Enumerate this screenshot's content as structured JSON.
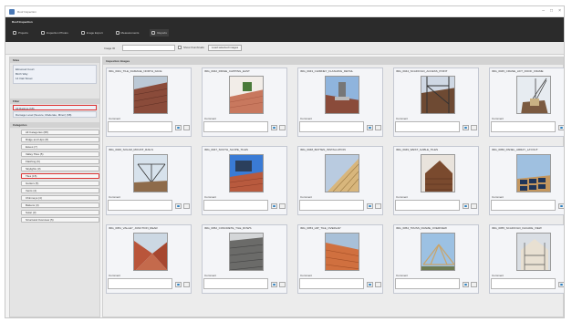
{
  "window": {
    "title": "Roof Inspection"
  },
  "ribbon": {
    "title": "Roof Inspection",
    "tabs": [
      {
        "label": "Projects",
        "active": false
      },
      {
        "label": "Inspection Photos",
        "active": false
      },
      {
        "label": "Image Export",
        "active": false
      },
      {
        "label": "Measurements",
        "active": false
      },
      {
        "label": "Reports",
        "active": true
      }
    ]
  },
  "toolbar": {
    "filter_label": "Image ID",
    "filter_value": "",
    "checkbox_label": "Show thumbnails",
    "button_label": "Load selected images"
  },
  "sidebar": {
    "sites_header": "Sites",
    "sites": [
      "Elmwood Court",
      "Birch Way",
      "14 Oak Street"
    ],
    "filter_header": "Filter",
    "filter_selected": "All Ratings (68)",
    "filter_combo": "Damage Level (Severe, Moderate, Minor) (68)",
    "category_header": "Categories",
    "categories": [
      {
        "label": "All Categories (68)",
        "highlighted": false
      },
      {
        "label": "Ridge and Hips (8)",
        "highlighted": false
      },
      {
        "label": "Eaves (7)",
        "highlighted": false
      },
      {
        "label": "Valley Tiles (5)",
        "highlighted": false
      },
      {
        "label": "Flashing (6)",
        "highlighted": false
      },
      {
        "label": "Skylights (3)",
        "highlighted": false
      },
      {
        "label": "Tiles (15)",
        "highlighted": true
      },
      {
        "label": "Gutters (5)",
        "highlighted": false
      },
      {
        "label": "Vents (4)",
        "highlighted": false
      },
      {
        "label": "Chimneys (4)",
        "highlighted": false
      },
      {
        "label": "Battens (3)",
        "highlighted": false
      },
      {
        "label": "Solar (3)",
        "highlighted": false
      },
      {
        "label": "Structural Overview (5)",
        "highlighted": false
      }
    ]
  },
  "main": {
    "header": "Inspection Images",
    "cards": [
      {
        "title": "IMG_0041_TILE_DAMAGE_NORTH_FACE",
        "label": "Comment",
        "photo": "roof-tiles"
      },
      {
        "title": "IMG_0042_RIDGE_CAPPING_EAST",
        "label": "Comment",
        "photo": "terracotta"
      },
      {
        "title": "IMG_0043_CHIMNEY_FLASHING_DETAIL",
        "label": "Comment",
        "photo": "chimney"
      },
      {
        "title": "IMG_0044_SCAFFOLD_ACCESS_POINT",
        "label": "Comment",
        "photo": "scaffold"
      },
      {
        "title": "IMG_0045_CRANE_LIFT_ROOF_FRAME",
        "label": "Comment",
        "photo": "crane"
      },
      {
        "title": "IMG_0046_SOLAR_MOUNT_RAILS",
        "label": "Comment",
        "photo": "solar-frame"
      },
      {
        "title": "IMG_0047_SOUTH_SLOPE_TILES",
        "label": "Comment",
        "photo": "blue-sky"
      },
      {
        "title": "IMG_0048_BATTEN_INSTALLATION",
        "label": "Comment",
        "photo": "timber"
      },
      {
        "title": "IMG_0049_WEST_GABLE_TILES",
        "label": "Comment",
        "photo": "gable"
      },
      {
        "title": "IMG_0050_PANEL_ARRAY_LAYOUT",
        "label": "Comment",
        "photo": "panels"
      },
      {
        "title": "IMG_0051_VALLEY_JUNCTION_REAR",
        "label": "Comment",
        "photo": "valley"
      },
      {
        "title": "IMG_0052_CONCRETE_TILE_ROWS",
        "label": "Comment",
        "photo": "grey-tiles"
      },
      {
        "title": "IMG_0053_HIP_TILE_OVERLAP",
        "label": "Comment",
        "photo": "orange-tiles"
      },
      {
        "title": "IMG_0054_TRUSS_FRAME_OVERVIEW",
        "label": "Comment",
        "photo": "truss"
      },
      {
        "title": "IMG_0055_SCAFFOLD_FACADE_VIEW",
        "label": "Comment",
        "photo": "facade"
      }
    ]
  }
}
